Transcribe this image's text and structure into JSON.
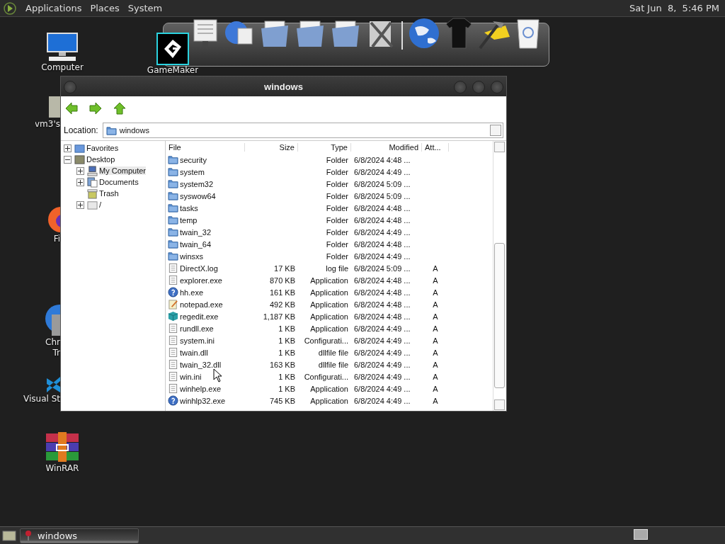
{
  "top_panel": {
    "menus": [
      "Applications",
      "Places",
      "System"
    ],
    "clock": "Sat Jun  8,  5:46 PM"
  },
  "desktop_icons": [
    {
      "kind": "computer",
      "labels": [
        "Computer"
      ]
    },
    {
      "kind": "gamemaker",
      "labels": [
        "GameMaker"
      ],
      "selected": true
    },
    {
      "kind": "drive",
      "labels": [
        "vm3's"
      ]
    },
    {
      "kind": "firefox",
      "labels": [
        "Fi"
      ]
    },
    {
      "kind": "chrome",
      "labels": [
        "Chr",
        "Tr"
      ]
    },
    {
      "kind": "vscode",
      "labels": [
        "Visual St"
      ]
    },
    {
      "kind": "winrar",
      "labels": [
        "WinRAR"
      ]
    }
  ],
  "window": {
    "title": "windows",
    "location_label": "Location:",
    "location": "windows",
    "tree": [
      {
        "label": "Favorites",
        "kind": "favorites",
        "expanded": false
      },
      {
        "label": "Desktop",
        "kind": "desktop",
        "expanded": true,
        "children": [
          {
            "label": "My Computer",
            "kind": "computer",
            "expanded": false,
            "selected": true
          },
          {
            "label": "Documents",
            "kind": "documents",
            "expanded": false
          },
          {
            "label": "Trash",
            "kind": "trash"
          },
          {
            "label": "/",
            "kind": "drive",
            "expanded": false
          }
        ]
      }
    ],
    "columns": [
      "File",
      "Size",
      "Type",
      "Modified",
      "Att..."
    ],
    "rows": [
      {
        "kind": "folder",
        "name": "security",
        "size": "",
        "type": "Folder",
        "modified": "6/8/2024 4:48 ...",
        "attr": ""
      },
      {
        "kind": "folder",
        "name": "system",
        "size": "",
        "type": "Folder",
        "modified": "6/8/2024 4:49 ...",
        "attr": ""
      },
      {
        "kind": "folder",
        "name": "system32",
        "size": "",
        "type": "Folder",
        "modified": "6/8/2024 5:09 ...",
        "attr": ""
      },
      {
        "kind": "folder",
        "name": "syswow64",
        "size": "",
        "type": "Folder",
        "modified": "6/8/2024 5:09 ...",
        "attr": ""
      },
      {
        "kind": "folder",
        "name": "tasks",
        "size": "",
        "type": "Folder",
        "modified": "6/8/2024 4:48 ...",
        "attr": ""
      },
      {
        "kind": "folder",
        "name": "temp",
        "size": "",
        "type": "Folder",
        "modified": "6/8/2024 4:48 ...",
        "attr": ""
      },
      {
        "kind": "folder",
        "name": "twain_32",
        "size": "",
        "type": "Folder",
        "modified": "6/8/2024 4:49 ...",
        "attr": ""
      },
      {
        "kind": "folder",
        "name": "twain_64",
        "size": "",
        "type": "Folder",
        "modified": "6/8/2024 4:48 ...",
        "attr": ""
      },
      {
        "kind": "folder",
        "name": "winsxs",
        "size": "",
        "type": "Folder",
        "modified": "6/8/2024 4:49 ...",
        "attr": ""
      },
      {
        "kind": "file",
        "name": "DirectX.log",
        "size": "17 KB",
        "type": "log file",
        "modified": "6/8/2024 5:09 ...",
        "attr": "A"
      },
      {
        "kind": "file",
        "name": "explorer.exe",
        "size": "870 KB",
        "type": "Application",
        "modified": "6/8/2024 4:48 ...",
        "attr": "A"
      },
      {
        "kind": "help",
        "name": "hh.exe",
        "size": "161 KB",
        "type": "Application",
        "modified": "6/8/2024 4:48 ...",
        "attr": "A"
      },
      {
        "kind": "notepad",
        "name": "notepad.exe",
        "size": "492 KB",
        "type": "Application",
        "modified": "6/8/2024 4:48 ...",
        "attr": "A"
      },
      {
        "kind": "cube",
        "name": "regedit.exe",
        "size": "1,187 KB",
        "type": "Application",
        "modified": "6/8/2024 4:48 ...",
        "attr": "A"
      },
      {
        "kind": "file",
        "name": "rundll.exe",
        "size": "1 KB",
        "type": "Application",
        "modified": "6/8/2024 4:49 ...",
        "attr": "A"
      },
      {
        "kind": "file",
        "name": "system.ini",
        "size": "1 KB",
        "type": "Configurati...",
        "modified": "6/8/2024 4:49 ...",
        "attr": "A"
      },
      {
        "kind": "file",
        "name": "twain.dll",
        "size": "1 KB",
        "type": "dllfile file",
        "modified": "6/8/2024 4:49 ...",
        "attr": "A"
      },
      {
        "kind": "file",
        "name": "twain_32.dll",
        "size": "163 KB",
        "type": "dllfile file",
        "modified": "6/8/2024 4:49 ...",
        "attr": "A"
      },
      {
        "kind": "file",
        "name": "win.ini",
        "size": "1 KB",
        "type": "Configurati...",
        "modified": "6/8/2024 4:49 ...",
        "attr": "A"
      },
      {
        "kind": "file",
        "name": "winhelp.exe",
        "size": "1 KB",
        "type": "Application",
        "modified": "6/8/2024 4:49 ...",
        "attr": "A"
      },
      {
        "kind": "help",
        "name": "winhlp32.exe",
        "size": "745 KB",
        "type": "Application",
        "modified": "6/8/2024 4:49 ...",
        "attr": "A"
      }
    ]
  },
  "taskbar": {
    "tasks": [
      {
        "label": "windows",
        "selected": true
      }
    ]
  }
}
